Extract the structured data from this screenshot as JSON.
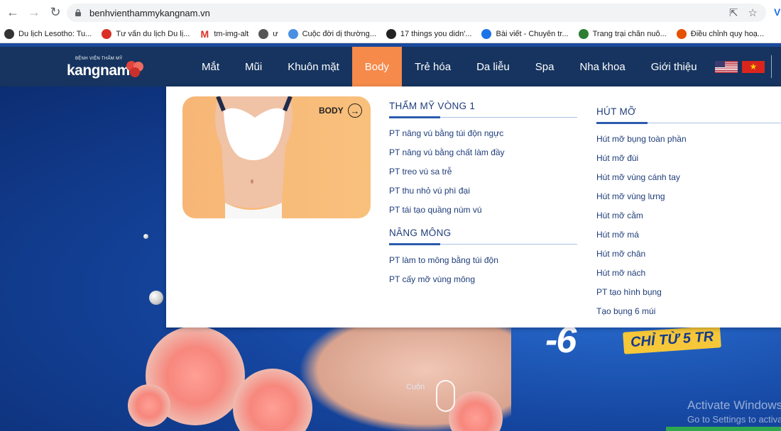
{
  "browser": {
    "url": "benhvienthammykangnam.vn",
    "bookmarks": [
      {
        "label": "Du lịch Lesotho: Tu...",
        "color": "#333333"
      },
      {
        "label": "Tư vấn du lịch Du lị...",
        "color": "#d93025"
      },
      {
        "label": "tm-img-alt",
        "color": "#d93025",
        "icon": "M"
      },
      {
        "label": "ư",
        "color": "#555555"
      },
      {
        "label": "Cuộc đời dị thường...",
        "color": "#4a90e2"
      },
      {
        "label": "17 things you didn'...",
        "color": "#222222"
      },
      {
        "label": "Bài viết - Chuyên tr...",
        "color": "#1a73e8"
      },
      {
        "label": "Trang trại chăn nuô...",
        "color": "#2e7d32"
      },
      {
        "label": "Điều chỉnh quy hoạ...",
        "color": "#e65100"
      }
    ]
  },
  "header": {
    "logo_tagline": "BỆNH VIỆN THẨM MỸ",
    "logo_brand": "kangnam",
    "menu": [
      "Mắt",
      "Mũi",
      "Khuôn mặt",
      "Body",
      "Trẻ hóa",
      "Da liễu",
      "Spa",
      "Nha khoa",
      "Giới thiệu"
    ],
    "active_menu": "Body",
    "accent_color": "#f58a4b",
    "header_color": "#16345f"
  },
  "mega_menu": {
    "feature_label": "BODY",
    "sections": [
      {
        "title": "THẨM MỸ VÒNG 1",
        "links": [
          "PT nâng vú bằng túi độn ngực",
          "PT nâng vú bằng chất làm đầy",
          "PT treo vú sa trễ",
          "PT thu nhỏ vú phì đại",
          "PT tái tạo quầng núm vú"
        ]
      },
      {
        "title": "NÂNG MÔNG",
        "links": [
          "PT làm to mông bằng túi độn",
          "PT cấy mỡ vùng mông"
        ]
      },
      {
        "title": "HÚT MỠ",
        "links": [
          "Hút mỡ bụng toàn phần",
          "Hút mỡ đùi",
          "Hút mỡ vùng cánh tay",
          "Hút mỡ vùng lưng",
          "Hút mỡ cằm",
          "Hút mỡ má",
          "Hút mỡ chân",
          "Hút mỡ nách",
          "PT tạo hình bụng",
          "Tạo bụng 6 múi"
        ]
      }
    ]
  },
  "hero": {
    "promo_text": "-6",
    "promo_badge": "CHỈ TỪ 5 TR",
    "scroll_label": "Cuộn"
  },
  "os_overlay": {
    "line1": "Activate Windows",
    "line2": "Go to Settings to activate Windows."
  }
}
